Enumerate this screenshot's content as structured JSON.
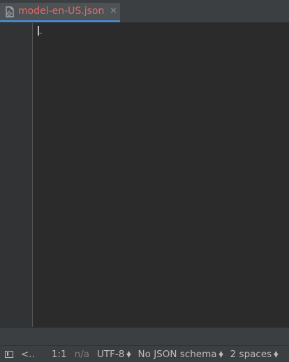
{
  "tab": {
    "file_name": "model-en-US.json",
    "close_glyph": "×",
    "icon": "json-file-gear-icon"
  },
  "status": {
    "toggle_icon": "toggle-tool-windows-icon",
    "nav": "<..",
    "position": "1:1",
    "na": "n/a",
    "encoding": "UTF-8",
    "schema": "No JSON schema",
    "indent": "2 spaces"
  },
  "colors": {
    "tab_label": "#e06c6c",
    "tab_underline": "#4a88c7",
    "editor_bg": "#2b2b2b",
    "chrome_bg": "#3c3f41"
  }
}
